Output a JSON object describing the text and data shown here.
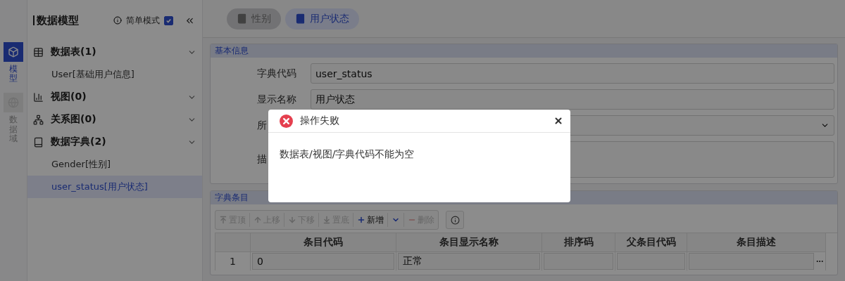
{
  "rail": [
    {
      "label": "模型",
      "selected": true
    },
    {
      "label": "数据域",
      "selected": false
    }
  ],
  "sidebar": {
    "title": "数据模型",
    "simple_mode": {
      "label": "简单模式",
      "checked": true
    },
    "groups": [
      {
        "label": "数据表(1)",
        "children": [
          {
            "label": "User[基础用户信息]",
            "selected": false
          }
        ]
      },
      {
        "label": "视图(0)"
      },
      {
        "label": "关系图(0)"
      },
      {
        "label": "数据字典(2)",
        "children": [
          {
            "label": "Gender[性别]",
            "selected": false
          },
          {
            "label": "user_status[用户状态]",
            "selected": true
          }
        ]
      }
    ]
  },
  "tabs": [
    {
      "label": "性别",
      "selected": false
    },
    {
      "label": "用户状态",
      "selected": true
    }
  ],
  "basic_info": {
    "title": "基本信息",
    "fields": [
      {
        "kind": "text",
        "label": "字典代码",
        "value": "user_status"
      },
      {
        "kind": "text",
        "label": "显示名称",
        "value": "用户状态"
      },
      {
        "kind": "select",
        "label": "所"
      },
      {
        "kind": "textarea",
        "label": "描"
      }
    ]
  },
  "entries": {
    "title": "字典条目",
    "toolbar": [
      {
        "kind": "top",
        "label": "置顶",
        "disabled": true
      },
      {
        "kind": "up",
        "label": "上移",
        "disabled": true
      },
      {
        "kind": "down",
        "label": "下移",
        "disabled": true
      },
      {
        "kind": "bottom",
        "label": "置底",
        "disabled": true
      },
      {
        "kind": "add",
        "label": "新增",
        "disabled": false
      },
      {
        "kind": "dropdown",
        "disabled": false
      },
      {
        "kind": "delete",
        "label": "删除",
        "disabled": true
      }
    ],
    "columns": [
      "条目代码",
      "条目显示名称",
      "排序码",
      "父条目代码",
      "条目描述"
    ],
    "rows": [
      {
        "number": "1",
        "cells": [
          "0",
          "正常"
        ]
      }
    ]
  },
  "dialog": {
    "title": "操作失败",
    "message": "数据表/视图/字典代码不能为空"
  }
}
